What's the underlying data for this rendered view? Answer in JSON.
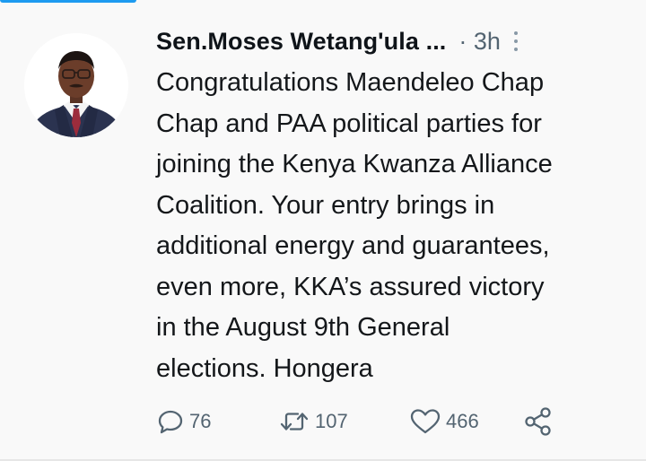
{
  "tweet": {
    "author_name": "Sen.Moses Wetang'ula ...",
    "time_meta": "· 3h",
    "text_lines": [
      "Congratulations Maendeleo Chap",
      "Chap and PAA political parties for",
      "joining the Kenya Kwanza Alliance",
      "Coalition. Your entry brings in",
      "additional energy and guarantees,",
      "even more, KKA’s assured victory",
      "in the August 9th General",
      "elections. Hongera"
    ],
    "actions": {
      "reply_count": "76",
      "retweet_count": "107",
      "like_count": "466"
    }
  },
  "colors": {
    "accent": "#1d9bf0",
    "text": "#14171a",
    "muted": "#536471",
    "background": "#f9f9f9"
  },
  "icons": {
    "reply": "reply-icon",
    "retweet": "retweet-icon",
    "like": "heart-icon",
    "share": "share-icon",
    "more": "more-options-icon"
  }
}
